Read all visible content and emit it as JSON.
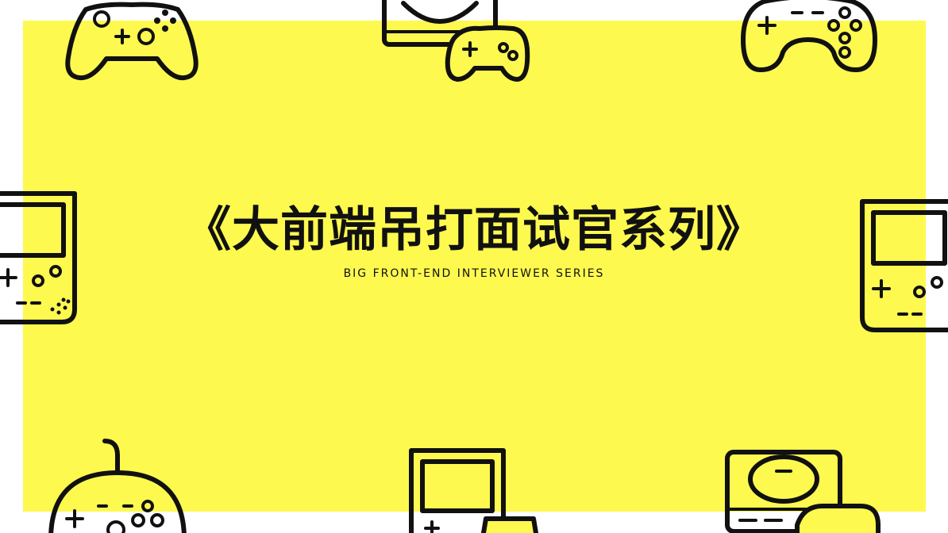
{
  "title": "《大前端吊打面试官系列》",
  "subtitle": "BIG FRONT-END INTERVIEWER SERIES",
  "colors": {
    "background": "#ffffff",
    "panel": "#fef94f",
    "ink": "#111111"
  },
  "icons": [
    "xbox-controller-icon",
    "retro-console-icon",
    "switch-controller-icon",
    "handheld-console-icon",
    "handheld-console-icon",
    "gamepad-icon",
    "handheld-console-icon",
    "retro-console-icon"
  ]
}
